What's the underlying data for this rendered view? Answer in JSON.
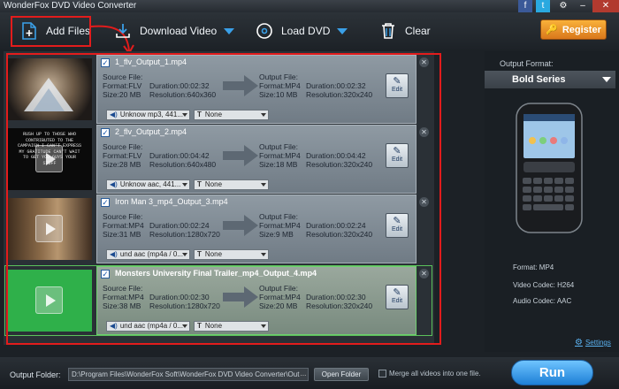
{
  "app": {
    "title": "WonderFox DVD Video Converter"
  },
  "toolbar": {
    "add_files": "Add Files",
    "download_video": "Download Video",
    "load_dvd": "Load DVD",
    "clear": "Clear",
    "register": "Register"
  },
  "files": [
    {
      "name": "1_flv_Output_1.mp4",
      "src_label": "Source File:",
      "src_format": "Format:FLV",
      "src_duration": "Duration:00:02:32",
      "src_size": "Size:20 MB",
      "src_resolution": "Resolution:640x360",
      "out_label": "Output File:",
      "out_format": "Format:MP4",
      "out_duration": "Duration:00:02:32",
      "out_size": "Size:10 MB",
      "out_resolution": "Resolution:320x240",
      "audio": "Unknow mp3, 441...",
      "subtitle": "None",
      "edit": "Edit"
    },
    {
      "name": "2_flv_Output_2.mp4",
      "src_label": "Source File:",
      "src_format": "Format:FLV",
      "src_duration": "Duration:00:04:42",
      "src_size": "Size:28 MB",
      "src_resolution": "Resolution:640x480",
      "out_label": "Output File:",
      "out_format": "Format:MP4",
      "out_duration": "Duration:00:04:42",
      "out_size": "Size:18 MB",
      "out_resolution": "Resolution:320x240",
      "audio": "Unknow aac, 441...",
      "subtitle": "None",
      "edit": "Edit"
    },
    {
      "name": "Iron Man 3_mp4_Output_3.mp4",
      "src_label": "Source File:",
      "src_format": "Format:MP4",
      "src_duration": "Duration:00:02:24",
      "src_size": "Size:31 MB",
      "src_resolution": "Resolution:1280x720",
      "out_label": "Output File:",
      "out_format": "Format:MP4",
      "out_duration": "Duration:00:02:24",
      "out_size": "Size:9 MB",
      "out_resolution": "Resolution:320x240",
      "audio": "und aac (mp4a / 0...",
      "subtitle": "None",
      "edit": "Edit"
    },
    {
      "name": "Monsters University Final Trailer_mp4_Output_4.mp4",
      "src_label": "Source File:",
      "src_format": "Format:MP4",
      "src_duration": "Duration:00:02:30",
      "src_size": "Size:38 MB",
      "src_resolution": "Resolution:1280x720",
      "out_label": "Output File:",
      "out_format": "Format:MP4",
      "out_duration": "Duration:00:02:30",
      "out_size": "Size:20 MB",
      "out_resolution": "Resolution:320x240",
      "audio": "und aac (mp4a / 0...",
      "subtitle": "None",
      "edit": "Edit"
    }
  ],
  "thumb2_text": "RUSH UP TO THOSE WHO CONTRIBUTED TO THE CAMPAIGN I CAN'T EXPRESS MY GRATITUDE CAN'T WAIT TO GET YOU GUYS YOUR STUFF",
  "right_panel": {
    "output_format_label": "Output Format:",
    "format": "Bold Series",
    "spec_format": "Format: MP4",
    "spec_video_codec": "Video Codec: H264",
    "spec_audio_codec": "Audio Codec: AAC",
    "settings": "Settings"
  },
  "bottom": {
    "output_folder_label": "Output Folder:",
    "output_path": "D:\\Program Files\\WonderFox Soft\\WonderFox DVD Video Converter\\Out",
    "more": "...",
    "open_folder": "Open Folder",
    "merge_label": "Merge all videos into one file.",
    "run": "Run"
  },
  "colors": {
    "accent_blue": "#3aa0e8",
    "highlight_red": "#e21c1c",
    "register_orange": "#f0a030"
  }
}
